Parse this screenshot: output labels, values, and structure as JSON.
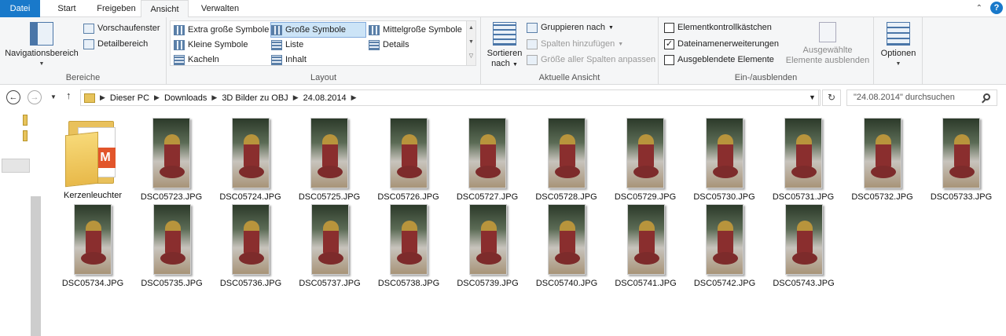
{
  "tabs": [
    "Datei",
    "Start",
    "Freigeben",
    "Ansicht",
    "Verwalten"
  ],
  "ribbon": {
    "bereiche": {
      "label": "Bereiche",
      "navigation": "Navigationsbereich",
      "preview": "Vorschaufenster",
      "details": "Detailbereich"
    },
    "layout": {
      "label": "Layout",
      "options": [
        "Extra große Symbole",
        "Große Symbole",
        "Mittelgroße Symbole",
        "Kleine Symbole",
        "Liste",
        "Details",
        "Kacheln",
        "Inhalt"
      ],
      "selected": "Große Symbole"
    },
    "view": {
      "label": "Aktuelle Ansicht",
      "sort_line1": "Sortieren",
      "sort_line2": "nach",
      "group": "Gruppieren nach",
      "add_columns": "Spalten hinzufügen",
      "fit_columns": "Größe aller Spalten anpassen"
    },
    "show_hide": {
      "label": "Ein-/ausblenden",
      "checkboxes": "Elementkontrollkästchen",
      "extensions": "Dateinamenerweiterungen",
      "hidden": "Ausgeblendete Elemente",
      "hide_selected_line1": "Ausgewählte",
      "hide_selected_line2": "Elemente ausblenden",
      "checked": {
        "checkboxes": false,
        "extensions": true,
        "hidden": false
      }
    },
    "options": "Optionen"
  },
  "address": {
    "crumbs": [
      "Dieser PC",
      "Downloads",
      "3D Bilder zu OBJ",
      "24.08.2014"
    ],
    "search_placeholder": "\"24.08.2014\" durchsuchen"
  },
  "files": {
    "folder": "Kerzenleuchter",
    "images": [
      "DSC05723.JPG",
      "DSC05724.JPG",
      "DSC05725.JPG",
      "DSC05726.JPG",
      "DSC05727.JPG",
      "DSC05728.JPG",
      "DSC05729.JPG",
      "DSC05730.JPG",
      "DSC05731.JPG",
      "DSC05732.JPG",
      "DSC05733.JPG",
      "DSC05734.JPG",
      "DSC05735.JPG",
      "DSC05736.JPG",
      "DSC05737.JPG",
      "DSC05738.JPG",
      "DSC05739.JPG",
      "DSC05740.JPG",
      "DSC05741.JPG",
      "DSC05742.JPG",
      "DSC05743.JPG"
    ]
  },
  "colors": {
    "accent": "#1979ca",
    "selection": "#cce4f7",
    "folder": "#e9c15c"
  }
}
